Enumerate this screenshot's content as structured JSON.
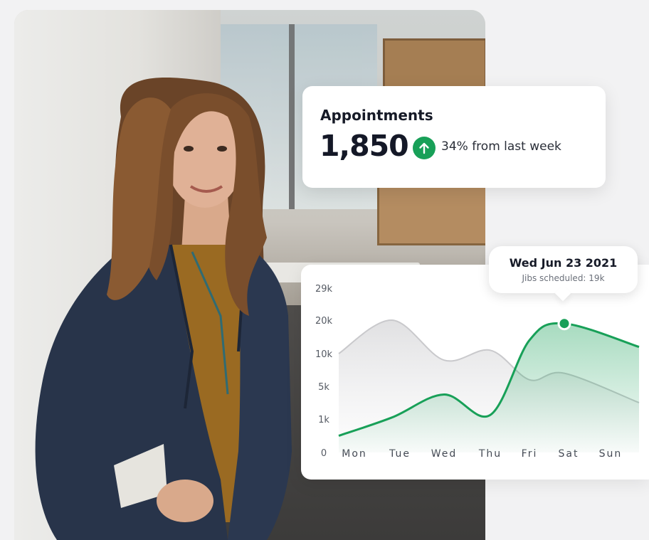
{
  "appointments": {
    "title": "Appointments",
    "value": "1,850",
    "trend_icon": "arrow-up-icon",
    "trend_text": "34% from last week",
    "accent_color": "#18a058"
  },
  "tooltip": {
    "date": "Wed Jun 23 2021",
    "subtitle": "Jibs scheduled: 19k"
  },
  "chart_data": {
    "type": "area",
    "categories": [
      "Mon",
      "Tue",
      "Wed",
      "Thu",
      "Fri",
      "Sat",
      "Sun"
    ],
    "y_tick_labels": [
      "0",
      "1k",
      "5k",
      "10k",
      "20k",
      "29k"
    ],
    "series": [
      {
        "values": [
          10000,
          20000,
          9000,
          11000,
          6000,
          7000,
          3000
        ],
        "color": "#cfcfd2"
      },
      {
        "values": [
          500,
          1200,
          4000,
          1500,
          14000,
          19000,
          12000
        ],
        "color": "#18a058"
      }
    ],
    "highlight": {
      "category": "Sat",
      "value": 19000
    },
    "grid": false,
    "legend": "none"
  }
}
